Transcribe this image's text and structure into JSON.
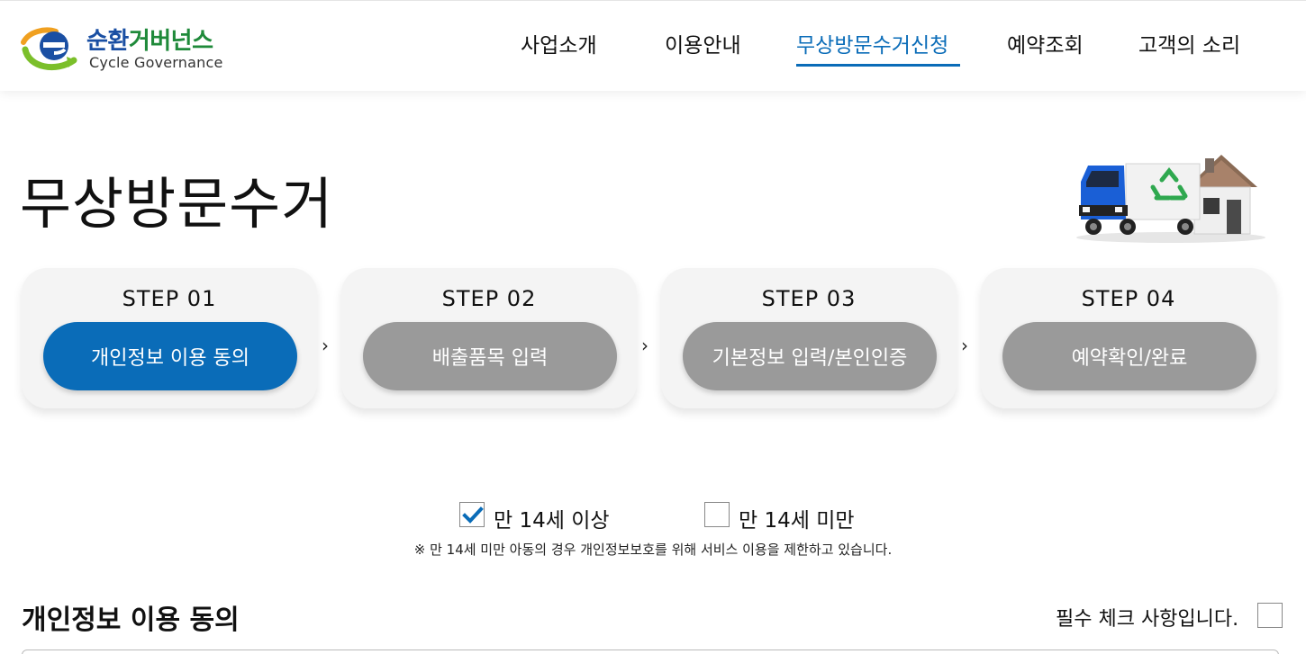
{
  "brand": {
    "name_ko_part1": "순환",
    "name_ko_part2": "거버넌스",
    "name_en": "Cycle Governance",
    "colors": {
      "blue": "#1a4fa3",
      "green": "#1f8a3a",
      "accent": "#0a6cb8"
    }
  },
  "nav": {
    "items": [
      {
        "label": "사업소개",
        "active": false
      },
      {
        "label": "이용안내",
        "active": false
      },
      {
        "label": "무상방문수거신청",
        "active": true
      },
      {
        "label": "예약조회",
        "active": false
      },
      {
        "label": "고객의 소리",
        "active": false
      }
    ]
  },
  "page": {
    "title": "무상방문수거",
    "illustration": "recycling-truck-and-house"
  },
  "steps": [
    {
      "label": "STEP 01",
      "pill": "개인정보 이용 동의",
      "active": true
    },
    {
      "label": "STEP 02",
      "pill": "배출품목 입력",
      "active": false
    },
    {
      "label": "STEP 03",
      "pill": "기본정보 입력/본인인증",
      "active": false
    },
    {
      "label": "STEP 04",
      "pill": "예약확인/완료",
      "active": false
    }
  ],
  "step_arrow": "›",
  "age": {
    "over14_label": "만 14세 이상",
    "over14_checked": true,
    "under14_label": "만 14세 미만",
    "under14_checked": false,
    "notice": "※ 만 14세 미만 아동의 경우 개인정보보호를 위해 서비스 이용을 제한하고 있습니다."
  },
  "consent": {
    "title": "개인정보 이용 동의",
    "required_label": "필수 체크 사항입니다.",
    "required_checked": false
  }
}
